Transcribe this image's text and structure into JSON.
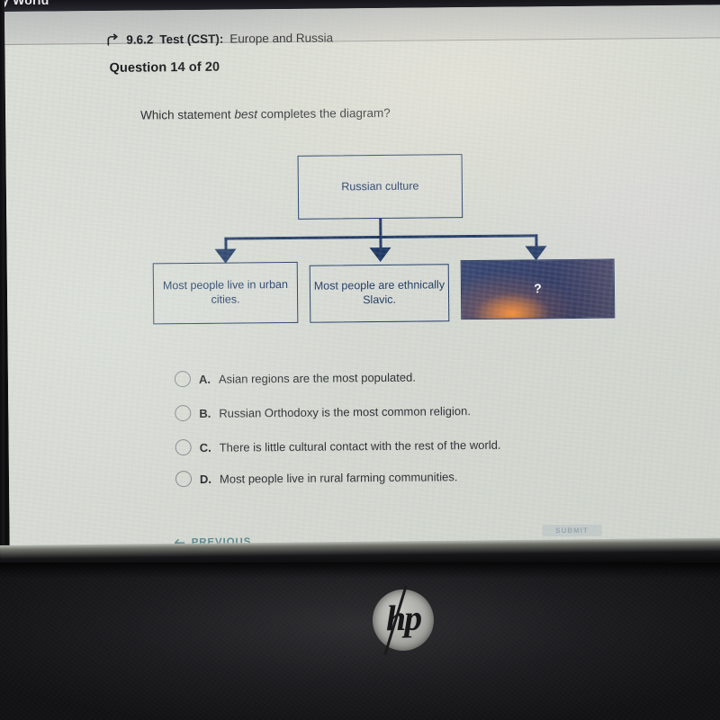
{
  "photo": {
    "device_logo": "hp",
    "partial_browser_tab_text": "y World"
  },
  "header": {
    "back_icon": "back-arrow-icon",
    "course_number": "9.6.2",
    "test_label": "Test (CST):",
    "test_title": "Europe and Russia",
    "question_counter": "Question 14 of 20"
  },
  "question": {
    "prompt_before": "Which statement ",
    "prompt_emphasis": "best",
    "prompt_after": " completes the diagram?"
  },
  "diagram": {
    "parent": "Russian culture",
    "children": [
      "Most people live in urban cities.",
      "Most people are ethnically Slavic.",
      "?"
    ],
    "accent_color": "#1f3864",
    "unknown_box_color": "#2b3560"
  },
  "answers": [
    {
      "letter": "A.",
      "text": "Asian regions are the most populated.",
      "selected": false
    },
    {
      "letter": "B.",
      "text": "Russian Orthodoxy is the most common religion.",
      "selected": false
    },
    {
      "letter": "C.",
      "text": "There is little cultural contact with the rest of the world.",
      "selected": false
    },
    {
      "letter": "D.",
      "text": "Most people live in rural farming communities.",
      "selected": false
    }
  ],
  "footer": {
    "previous_label": "PREVIOUS",
    "previous_icon": "arrow-left-icon",
    "submit_label": "SUBMIT",
    "link_color": "#5f8b92"
  }
}
